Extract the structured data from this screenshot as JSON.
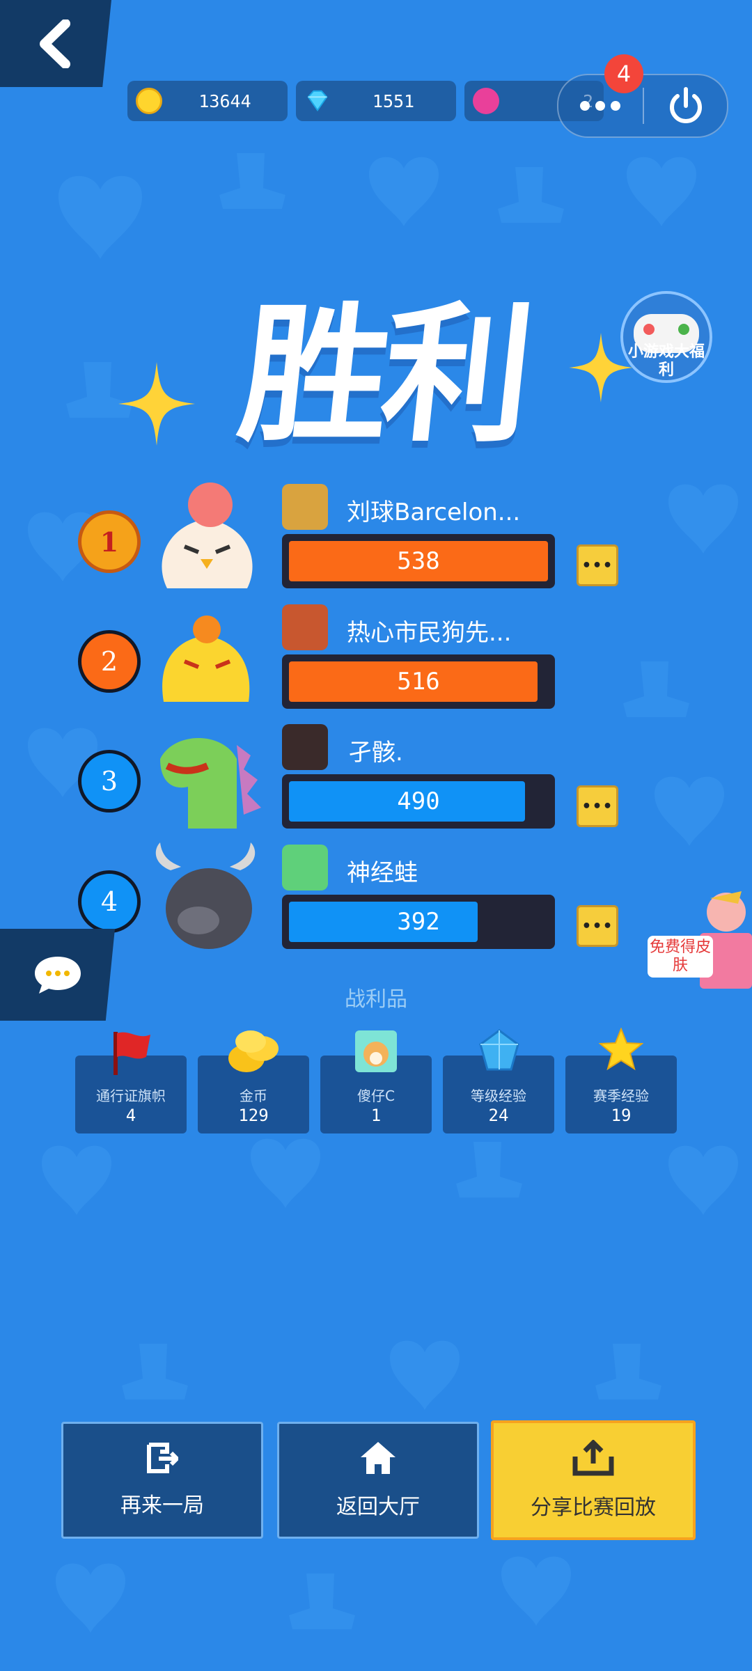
{
  "currency": {
    "coins": "13644",
    "diamonds": "1551",
    "tickets": "2"
  },
  "capsule": {
    "badge_count": "4"
  },
  "title": "胜利",
  "promo": {
    "game_welfare": "小游戏大福利",
    "free_skin": "免费得皮肤"
  },
  "ranking": [
    {
      "rank": "1",
      "name": "刘球Barcelon...",
      "score": "538",
      "fraction": 1.0,
      "color": "#fb6a17"
    },
    {
      "rank": "2",
      "name": "热心市民狗先...",
      "score": "516",
      "fraction": 0.959,
      "color": "#fb6a17"
    },
    {
      "rank": "3",
      "name": "孑骸.",
      "score": "490",
      "fraction": 0.911,
      "color": "#1092f6"
    },
    {
      "rank": "4",
      "name": "神经蛙",
      "score": "392",
      "fraction": 0.729,
      "color": "#1092f6"
    }
  ],
  "spoils": {
    "title": "战利品",
    "items": [
      {
        "label": "通行证旗帜",
        "value": "4"
      },
      {
        "label": "金币",
        "value": "129"
      },
      {
        "label": "傻仔C",
        "value": "1"
      },
      {
        "label": "等级经验",
        "value": "24"
      },
      {
        "label": "赛季经验",
        "value": "19"
      }
    ]
  },
  "buttons": {
    "again": "再来一局",
    "lobby": "返回大厅",
    "share": "分享比赛回放"
  },
  "colors": {
    "background": "#2b88e8",
    "orange_bar": "#fb6a17",
    "blue_bar": "#1092f6",
    "gold": "#f8cf33"
  }
}
